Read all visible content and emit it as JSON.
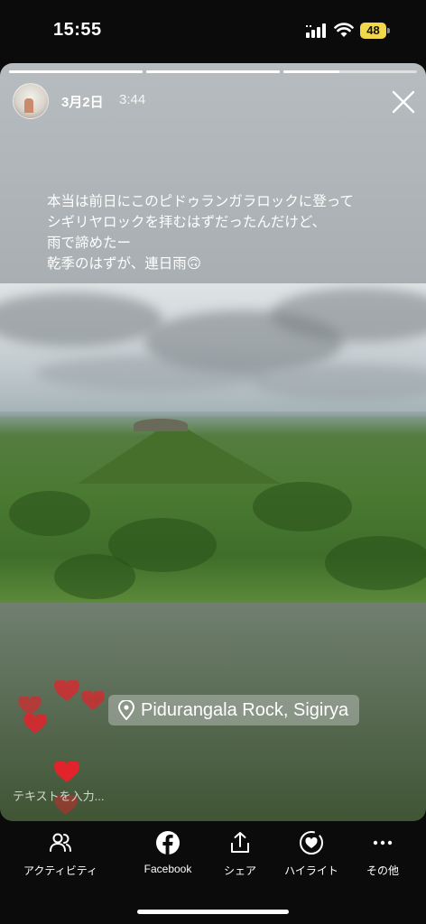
{
  "status_bar": {
    "time": "15:55",
    "battery": "48"
  },
  "story": {
    "progress": [
      1,
      1,
      0.42
    ],
    "date": "3月2日",
    "time_ago": "3:44",
    "caption_lines": [
      "本当は前日にこのピドゥランガラロックに登って",
      "シギリヤロックを拝むはずだったんだけど、",
      "雨で諦めたー",
      "乾季のはずが、連日雨🙃"
    ],
    "location": "Pidurangala Rock, Sigirya",
    "reply_placeholder": "テキストを入力..."
  },
  "actions": [
    {
      "label": "アクティビティ",
      "icon": "people-icon"
    },
    {
      "label": "Facebook",
      "icon": "facebook-icon"
    },
    {
      "label": "シェア",
      "icon": "share-icon"
    },
    {
      "label": "ハイライト",
      "icon": "highlight-heart-icon"
    },
    {
      "label": "その他",
      "icon": "more-icon"
    }
  ],
  "colors": {
    "heart": "#e2232b",
    "battery": "#f0d84a"
  }
}
